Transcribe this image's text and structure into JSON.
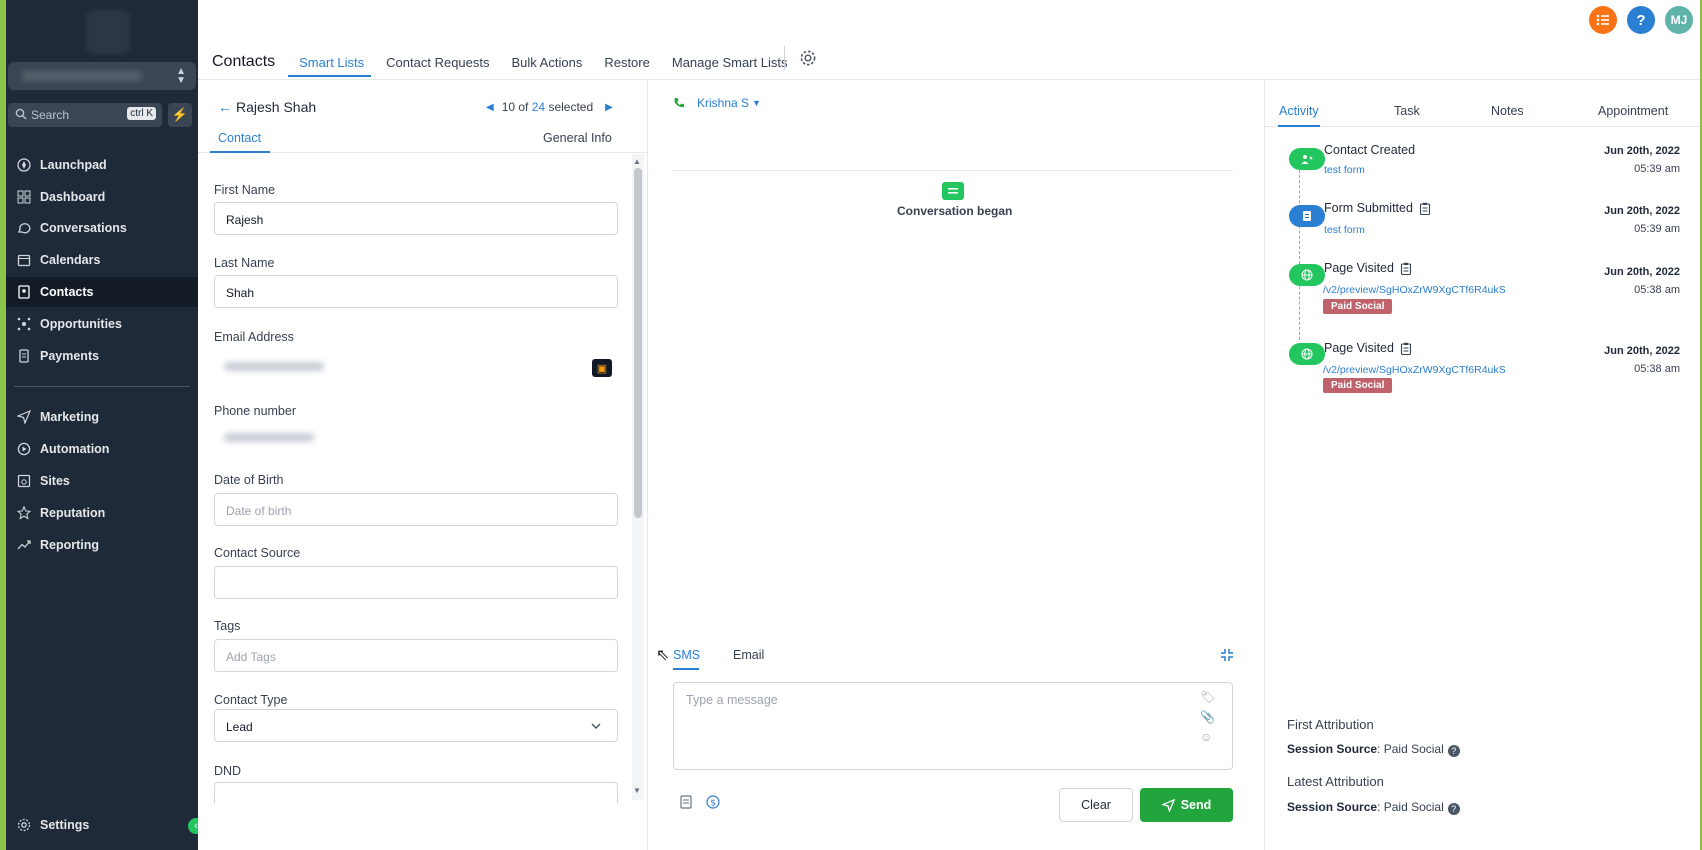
{
  "app": {
    "section_title": "Contacts",
    "top_tabs": [
      {
        "label": "Smart Lists",
        "active": true
      },
      {
        "label": "Contact Requests",
        "active": false
      },
      {
        "label": "Bulk Actions",
        "active": false
      },
      {
        "label": "Restore",
        "active": false
      },
      {
        "label": "Manage Smart Lists",
        "active": false
      }
    ],
    "avatar_initials": "MJ",
    "help_label": "?",
    "accent": "#2b7fd3",
    "success": "#22a53c"
  },
  "sidebar": {
    "search_placeholder": "Search",
    "search_shortcut": "ctrl K",
    "items": [
      {
        "label": "Launchpad",
        "icon": "rocket-icon"
      },
      {
        "label": "Dashboard",
        "icon": "grid-icon"
      },
      {
        "label": "Conversations",
        "icon": "chat-icon"
      },
      {
        "label": "Calendars",
        "icon": "calendar-icon"
      },
      {
        "label": "Contacts",
        "icon": "address-book-icon",
        "active": true
      },
      {
        "label": "Opportunities",
        "icon": "opportunities-icon"
      },
      {
        "label": "Payments",
        "icon": "payments-icon"
      },
      {
        "label": "Marketing",
        "icon": "send-icon"
      },
      {
        "label": "Automation",
        "icon": "automation-icon"
      },
      {
        "label": "Sites",
        "icon": "sites-icon"
      },
      {
        "label": "Reputation",
        "icon": "star-icon"
      },
      {
        "label": "Reporting",
        "icon": "trend-icon"
      }
    ],
    "settings_label": "Settings"
  },
  "contact": {
    "name": "Rajesh Shah",
    "pager": {
      "current": "10 of",
      "total": "24",
      "suffix": "selected"
    },
    "tabs": {
      "contact": "Contact",
      "general": "General Info"
    },
    "fields": {
      "first_name_label": "First Name",
      "first_name_value": "Rajesh",
      "last_name_label": "Last Name",
      "last_name_value": "Shah",
      "email_label": "Email Address",
      "phone_label": "Phone number",
      "dob_label": "Date of Birth",
      "dob_placeholder": "Date of birth",
      "source_label": "Contact Source",
      "tags_label": "Tags",
      "tags_placeholder": "Add Tags",
      "type_label": "Contact Type",
      "type_value": "Lead",
      "dnd_label": "DND"
    }
  },
  "conversation": {
    "caller": "Krishna S",
    "began_text": "Conversation began",
    "tabs": {
      "sms": "SMS",
      "email": "Email"
    },
    "message_placeholder": "Type a message",
    "clear_label": "Clear",
    "send_label": "Send"
  },
  "activity": {
    "tabs": [
      {
        "label": "Activity",
        "active": true
      },
      {
        "label": "Task",
        "active": false
      },
      {
        "label": "Notes",
        "active": false
      },
      {
        "label": "Appointment",
        "active": false
      }
    ],
    "events": [
      {
        "title": "Contact Created",
        "sub": "test form",
        "date": "Jun 20th, 2022",
        "time": "05:39 am",
        "color": "#22c55e",
        "badge": ""
      },
      {
        "title": "Form Submitted",
        "sub": "test form",
        "date": "Jun 20th, 2022",
        "time": "05:39 am",
        "color": "#2b7fd3",
        "badge": ""
      },
      {
        "title": "Page Visited",
        "sub": "/v2/preview/SgHOxZrW9XgCTf6R4ukS",
        "date": "Jun 20th, 2022",
        "time": "05:38 am",
        "color": "#22c55e",
        "badge": "Paid Social"
      },
      {
        "title": "Page Visited",
        "sub": "/v2/preview/SgHOxZrW9XgCTf6R4ukS",
        "date": "Jun 20th, 2022",
        "time": "05:38 am",
        "color": "#22c55e",
        "badge": "Paid Social"
      }
    ],
    "first_attribution_title": "First Attribution",
    "latest_attribution_title": "Latest Attribution",
    "session_source_label": "Session Source",
    "first_session_source": "Paid Social",
    "latest_session_source": "Paid Social"
  }
}
